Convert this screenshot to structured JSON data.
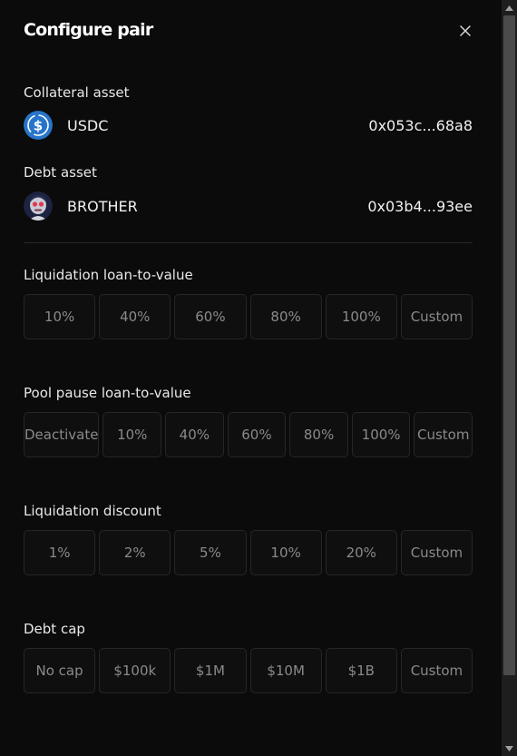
{
  "dialog": {
    "title": "Configure pair",
    "close_symbol": "×"
  },
  "collateral": {
    "label": "Collateral asset",
    "symbol": "USDC",
    "address": "0x053c...68a8",
    "icon": "usdc-icon"
  },
  "debt": {
    "label": "Debt asset",
    "symbol": "BROTHER",
    "address": "0x03b4...93ee",
    "icon": "brother-avatar-icon"
  },
  "liquidation_ltv": {
    "label": "Liquidation loan-to-value",
    "options": [
      "10%",
      "40%",
      "60%",
      "80%",
      "100%",
      "Custom"
    ]
  },
  "pool_pause_ltv": {
    "label": "Pool pause loan-to-value",
    "options": [
      "Deactivate",
      "10%",
      "40%",
      "60%",
      "80%",
      "100%",
      "Custom"
    ]
  },
  "liquidation_discount": {
    "label": "Liquidation discount",
    "options": [
      "1%",
      "2%",
      "5%",
      "10%",
      "20%",
      "Custom"
    ]
  },
  "debt_cap": {
    "label": "Debt cap",
    "options": [
      "No cap",
      "$100k",
      "$1M",
      "$10M",
      "$1B",
      "Custom"
    ]
  },
  "colors": {
    "background": "#0b0b0b",
    "option_border": "#262626",
    "option_text": "#8a8a8a",
    "usdc_blue": "#2775ca"
  }
}
